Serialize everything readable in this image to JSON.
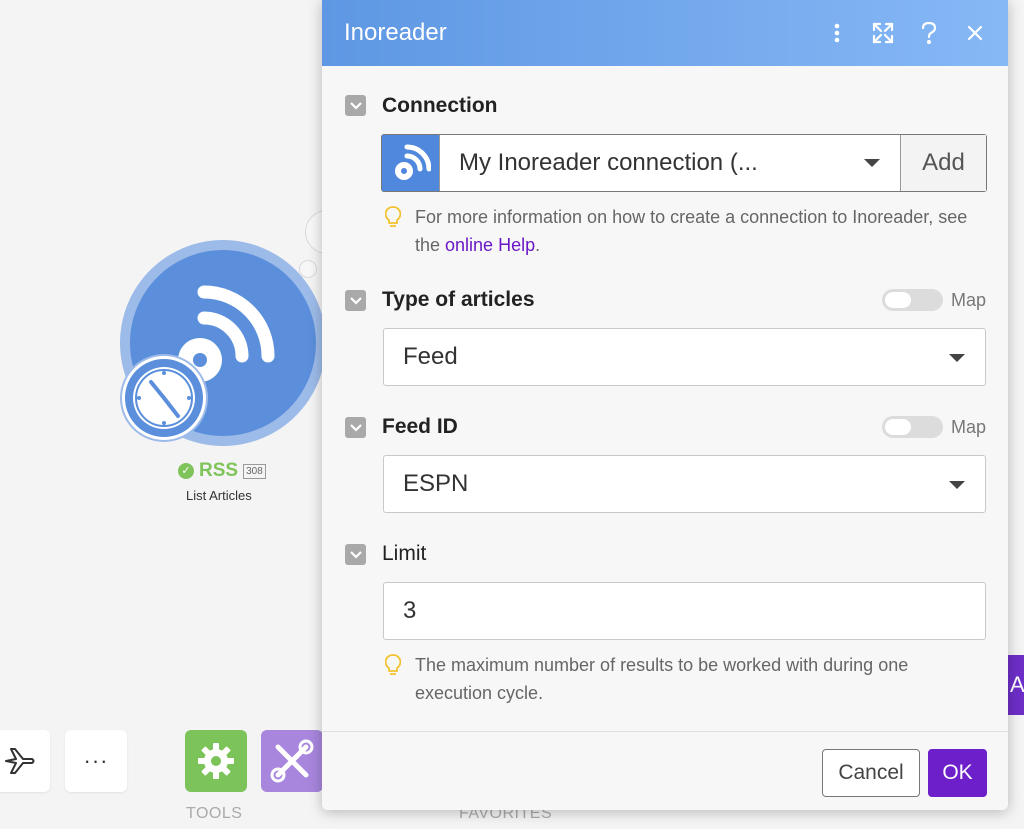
{
  "canvas": {
    "module": {
      "name": "RSS",
      "badge": "308",
      "subtitle": "List Articles",
      "status_color": "#7fc45a"
    },
    "toolbar": {
      "tools_caption": "TOOLS",
      "favorites_caption": "FAVORITES",
      "more_label": "···"
    },
    "edge_button_label": "A"
  },
  "dialog": {
    "title": "Inoreader",
    "header_icons": [
      "more-vertical-icon",
      "expand-icon",
      "help-icon",
      "close-icon"
    ],
    "connection": {
      "label": "Connection",
      "selected": "My Inoreader connection (...",
      "add_label": "Add",
      "hint_prefix": "For more information on how to create a connection to Inoreader, see the ",
      "hint_link": "online Help",
      "hint_suffix": "."
    },
    "type_of_articles": {
      "label": "Type of articles",
      "map_label": "Map",
      "selected": "Feed"
    },
    "feed_id": {
      "label": "Feed ID",
      "map_label": "Map",
      "selected": "ESPN"
    },
    "limit": {
      "label": "Limit",
      "value": "3",
      "hint": "The maximum number of results to be worked with during one execution cycle."
    },
    "footer": {
      "cancel_label": "Cancel",
      "ok_label": "OK"
    }
  },
  "colors": {
    "header_start": "#5e97e3",
    "header_end": "#86b8f5",
    "ok_button": "#6d1fc9",
    "link": "#6a18c6"
  }
}
